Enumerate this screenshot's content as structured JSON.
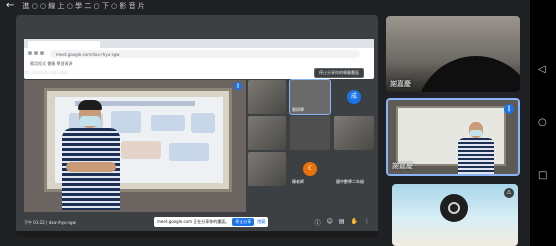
{
  "top_bar": {
    "back_glyph": "←",
    "title": "進 ○ ○ 線 上 ○ 學 二 ○ 下 ○ 影 音 片"
  },
  "presentation": {
    "browser": {
      "url": "meet.google.com/dxa-rhyu-sgw",
      "bookmarks": "應用程式  書籤  學習資源"
    },
    "meet_info_label": "你正在向所有人展示畫面",
    "present_button": "停止分享你的螢幕畫面",
    "main_mic_glyph": "∥",
    "tiles": [
      {
        "name": "",
        "avatar": ""
      },
      {
        "name": "張同學",
        "avatar": ""
      },
      {
        "name": "",
        "avatar": "成"
      },
      {
        "name": "",
        "avatar": ""
      },
      {
        "name": "",
        "avatar": ""
      },
      {
        "name": "",
        "avatar": ""
      },
      {
        "name": "陳老師",
        "avatar": "ℂ"
      },
      {
        "name": "國中數學二年級",
        "avatar": ""
      },
      {
        "name": "",
        "avatar": ""
      }
    ],
    "meeting_code": "下午 01:22 | dxa-rhyu-sgw",
    "share_pill": {
      "text": "meet.google.com 正在分享你的畫面。",
      "stop_label": "停止分享",
      "hide_label": "隱藏"
    },
    "controls": [
      "ⓘ",
      "☺",
      "▤",
      "✋",
      "⋮"
    ]
  },
  "participants": [
    {
      "name": "謝嘉慶",
      "status_glyph": ""
    },
    {
      "name": "謝嘉慶",
      "status_glyph": "∥"
    },
    {
      "name": "",
      "status_glyph": "⚠"
    }
  ],
  "navbar": {
    "back": "◁",
    "home": "○",
    "recent": "□"
  }
}
